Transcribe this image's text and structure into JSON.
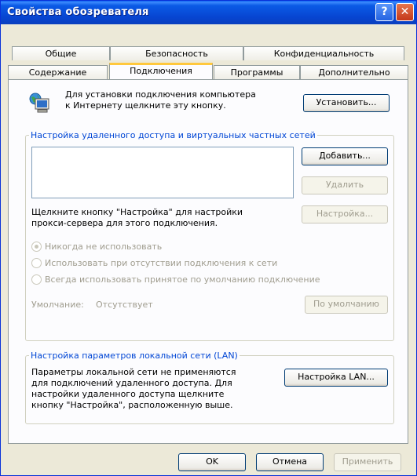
{
  "window": {
    "title": "Свойства обозревателя"
  },
  "titlebar": {
    "help_glyph": "?",
    "close_glyph": "✕"
  },
  "tabs_row1": [
    "Общие",
    "Безопасность",
    "Конфиденциальность"
  ],
  "tabs_row2": [
    "Содержание",
    "Подключения",
    "Программы",
    "Дополнительно"
  ],
  "active_tab": "Подключения",
  "setup": {
    "text_line1": "Для установки подключения компьютера",
    "text_line2": "к Интернету щелкните эту кнопку.",
    "button": "Установить..."
  },
  "dialup": {
    "legend": "Настройка удаленного доступа и виртуальных частных сетей",
    "add_button": "Добавить...",
    "remove_button": "Удалить",
    "proxy_text_line1": "Щелкните кнопку \"Настройка\" для настройки",
    "proxy_text_line2": "прокси-сервера для этого подключения.",
    "settings_button": "Настройка...",
    "options": [
      "Никогда не использовать",
      "Использовать при отсутствии подключения к сети",
      "Всегда использовать принятое по умолчанию подключение"
    ],
    "selected_option": 0,
    "default_label": "Умолчание:",
    "default_value": "Отсутствует",
    "default_button": "По умолчанию"
  },
  "lan": {
    "legend": "Настройка параметров локальной сети (LAN)",
    "text_line1": "Параметры локальной сети не применяются",
    "text_line2": "для подключений удаленного доступа. Для",
    "text_line3": "настройки удаленного доступа щелкните",
    "text_line4": "кнопку \"Настройка\", расположенную выше.",
    "button": "Настройка LAN..."
  },
  "footer": {
    "ok": "OK",
    "cancel": "Отмена",
    "apply": "Применить"
  }
}
